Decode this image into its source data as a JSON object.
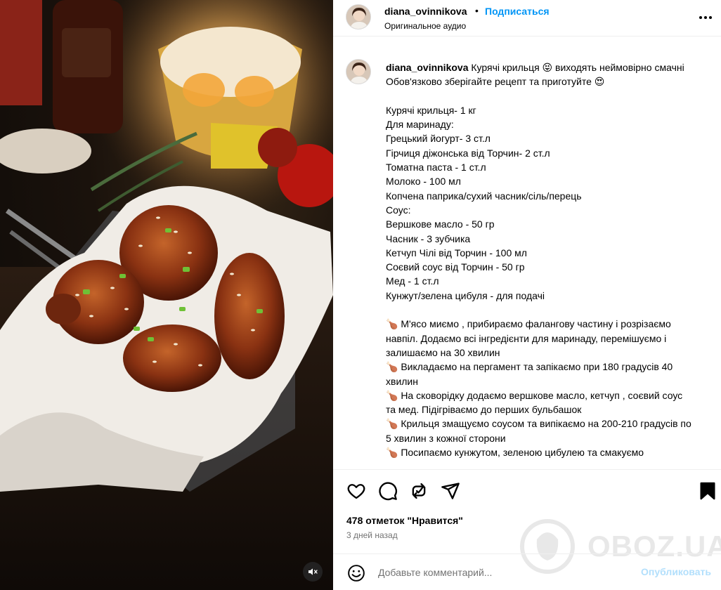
{
  "post": {
    "username": "diana_ovinnikova",
    "separator": "•",
    "follow_label": "Подписаться",
    "audio_label": "Оригинальное аудио",
    "more_icon": "more-horizontal-icon"
  },
  "caption": {
    "username": "diana_ovinnikova",
    "lines": [
      "Курячі крильця 😝 виходять неймовірно смачні",
      "Обов'язково зберігайте рецепт та приготуйте 😍",
      "",
      "Курячі крильця- 1 кг",
      "Для маринаду:",
      "Грецький йогурт- 3 ст.л",
      "Гірчиця діжонська від Торчин- 2 ст.л",
      "Томатна паста - 1 ст.л",
      "Молоко - 100 мл",
      "Копчена паприка/сухий часник/сіль/перець",
      "Соус:",
      "Вершкове масло - 50 гр",
      "Часник - 3 зубчика",
      "Кетчуп Чілі від Торчин - 100 мл",
      "Соєвий соус від Торчин - 50 гр",
      "Мед - 1 ст.л",
      "Кунжут/зелена цибуля - для подачі",
      "",
      "🍗 М'ясо миємо , прибираємо фалангову частину і розрізаємо навпіл. Додаємо всі інгредієнти для маринаду, перемішуємо і залишаємо на 30 хвилин",
      "🍗 Викладаємо на пергамент та запікаємо при 180 градусів 40 хвилин",
      "🍗 На сковорідку додаємо вершкове масло, кетчуп , соєвий соус та мед. Підігріваємо до перших бульбашок",
      "🍗 Крильця змащуємо соусом та випікаємо на 200-210 градусів по 5 хвилин з кожної сторони",
      "🍗 Посипаємо кунжутом, зеленою цибулею та смакуємо"
    ]
  },
  "actions": {
    "like_icon": "heart-icon",
    "comment_icon": "comment-icon",
    "repost_icon": "repost-icon",
    "share_icon": "send-icon",
    "save_icon": "bookmark-icon"
  },
  "stats": {
    "likes_text": "478 отметок \"Нравится\"",
    "date_text": "3 дней назад"
  },
  "comment": {
    "placeholder": "Добавьте комментарий...",
    "publish_label": "Опубликовать"
  },
  "watermark": {
    "text": "OBOZ.UA"
  },
  "media": {
    "mute_icon": "muted-speaker-icon"
  }
}
